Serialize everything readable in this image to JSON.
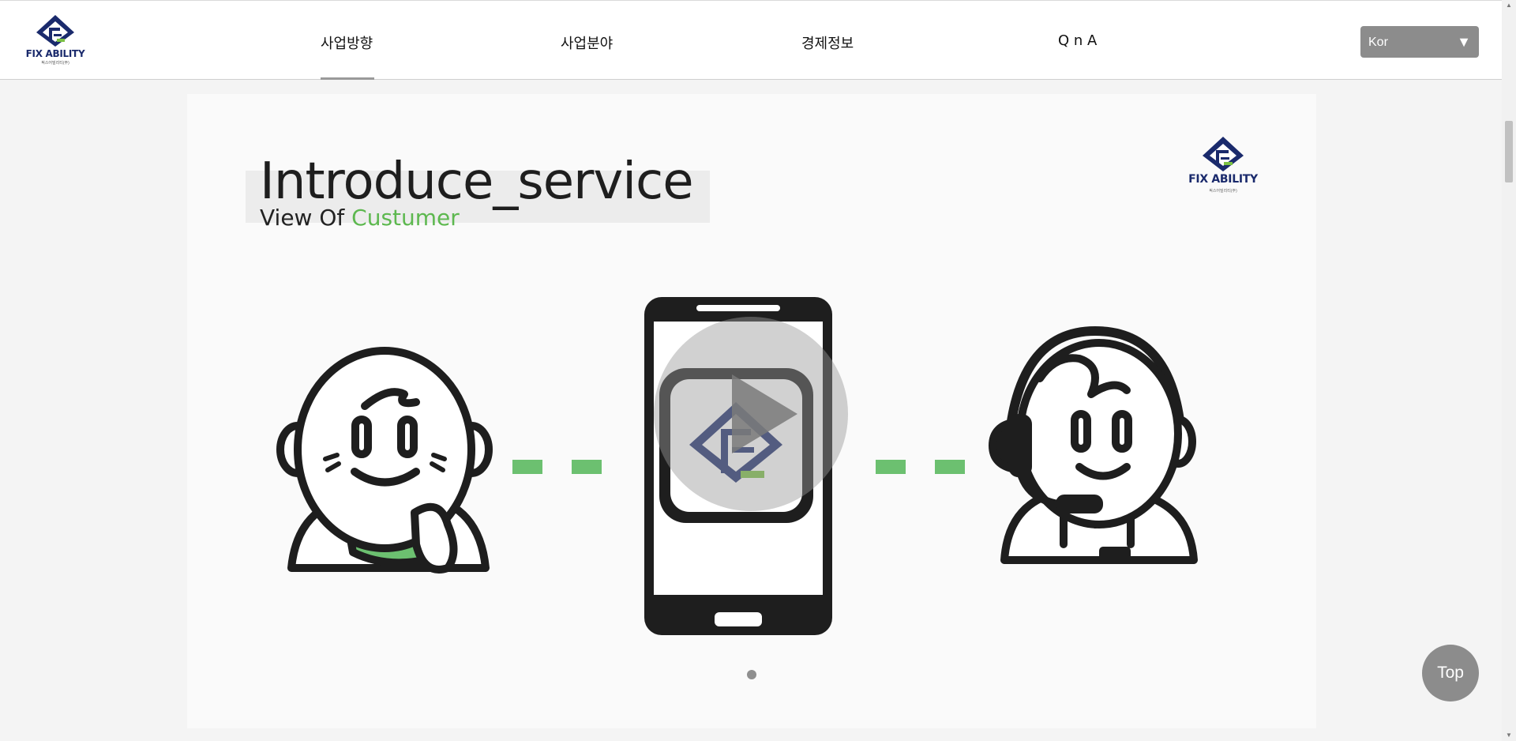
{
  "header": {
    "logo": {
      "text": "FIX ABILITY",
      "subtext": "픽스어빌리티(주)",
      "icon": "fix-ability-logo-icon"
    },
    "nav": [
      {
        "label": "사업방향",
        "active": true
      },
      {
        "label": "사업분야",
        "active": false
      },
      {
        "label": "경제정보",
        "active": false
      },
      {
        "label": "Q n A",
        "active": false
      }
    ],
    "language": {
      "selected": "Kor",
      "icon": "triangle-down-icon"
    }
  },
  "slide": {
    "title": "Introduce_service",
    "subtitle_prefix": "View Of ",
    "subtitle_highlight": "Custumer",
    "logo_text": "FIX ABILITY",
    "logo_subtext": "픽스어빌리티(주)",
    "illustration": {
      "left": "customer-character",
      "center": "smartphone-with-app-icon",
      "right": "call-center-agent-character",
      "connector": "green-dashed-line"
    },
    "play_icon": "play-icon",
    "pagination": {
      "count": 1,
      "active": 0
    }
  },
  "top_button": {
    "label": "Top"
  },
  "colors": {
    "brand_navy": "#1a2a6c",
    "brand_green": "#5db84f",
    "nav_active_bar": "#9a9a9a",
    "button_gray": "#8c8c8c"
  }
}
